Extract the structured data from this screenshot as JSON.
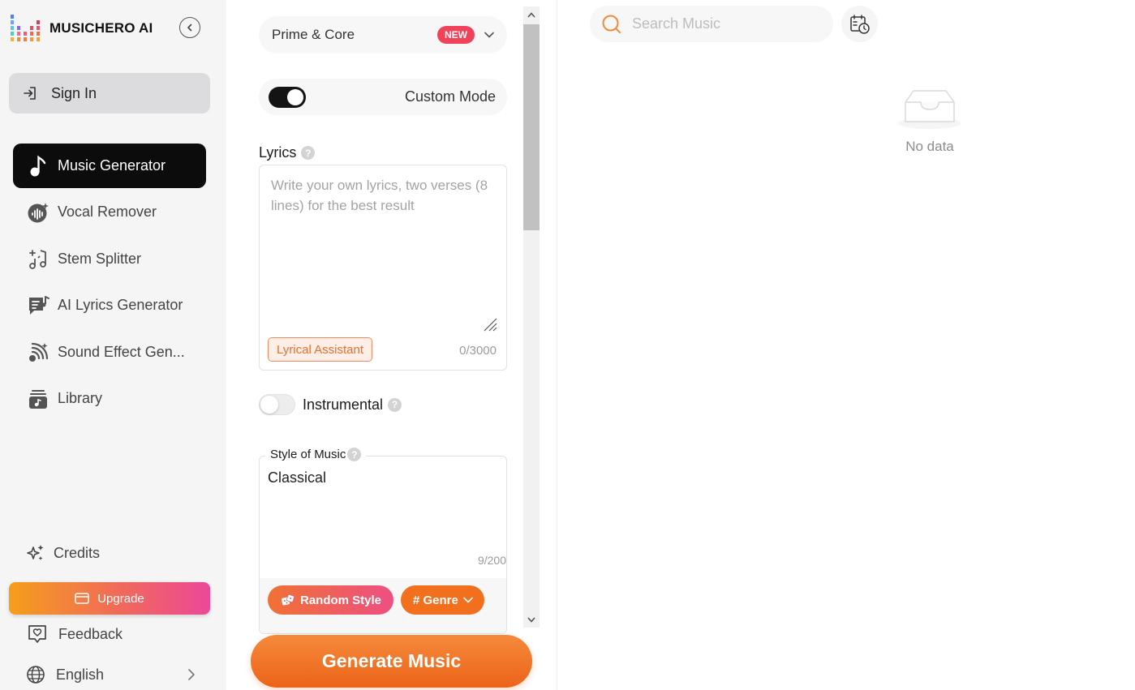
{
  "brand": {
    "name": "MUSICHERO AI"
  },
  "sidebar": {
    "sign_in": "Sign In",
    "nav": [
      {
        "label": "Music Generator",
        "icon": "music-note-icon",
        "active": true
      },
      {
        "label": "Vocal Remover",
        "icon": "vocal-remover-icon",
        "active": false
      },
      {
        "label": "Stem Splitter",
        "icon": "stem-splitter-icon",
        "active": false
      },
      {
        "label": "AI Lyrics Generator",
        "icon": "lyrics-icon",
        "active": false
      },
      {
        "label": "Sound Effect Gen...",
        "icon": "sound-effect-icon",
        "active": false
      },
      {
        "label": "Library",
        "icon": "library-icon",
        "active": false
      }
    ],
    "credits": "Credits",
    "upgrade": "Upgrade",
    "feedback": "Feedback",
    "language": "English"
  },
  "form": {
    "model": {
      "value": "Prime & Core",
      "badge": "NEW"
    },
    "custom_mode": {
      "label": "Custom Mode",
      "on": true
    },
    "lyrics": {
      "label": "Lyrics",
      "placeholder": "Write your own lyrics, two verses (8 lines) for the best result",
      "value": "",
      "count": "0/3000",
      "assistant": "Lyrical Assistant"
    },
    "instrumental": {
      "label": "Instrumental",
      "on": false
    },
    "style": {
      "label": "Style of Music",
      "value": "Classical",
      "count": "9/200",
      "random_button": "Random Style",
      "genre_button": "# Genre"
    },
    "generate_button": "Generate Music"
  },
  "right": {
    "search_placeholder": "Search Music",
    "empty_text": "No data"
  },
  "colors": {
    "accent_orange": "#f26f1e",
    "new_badge": "#f0435a",
    "active_nav": "#0c0c0c"
  }
}
